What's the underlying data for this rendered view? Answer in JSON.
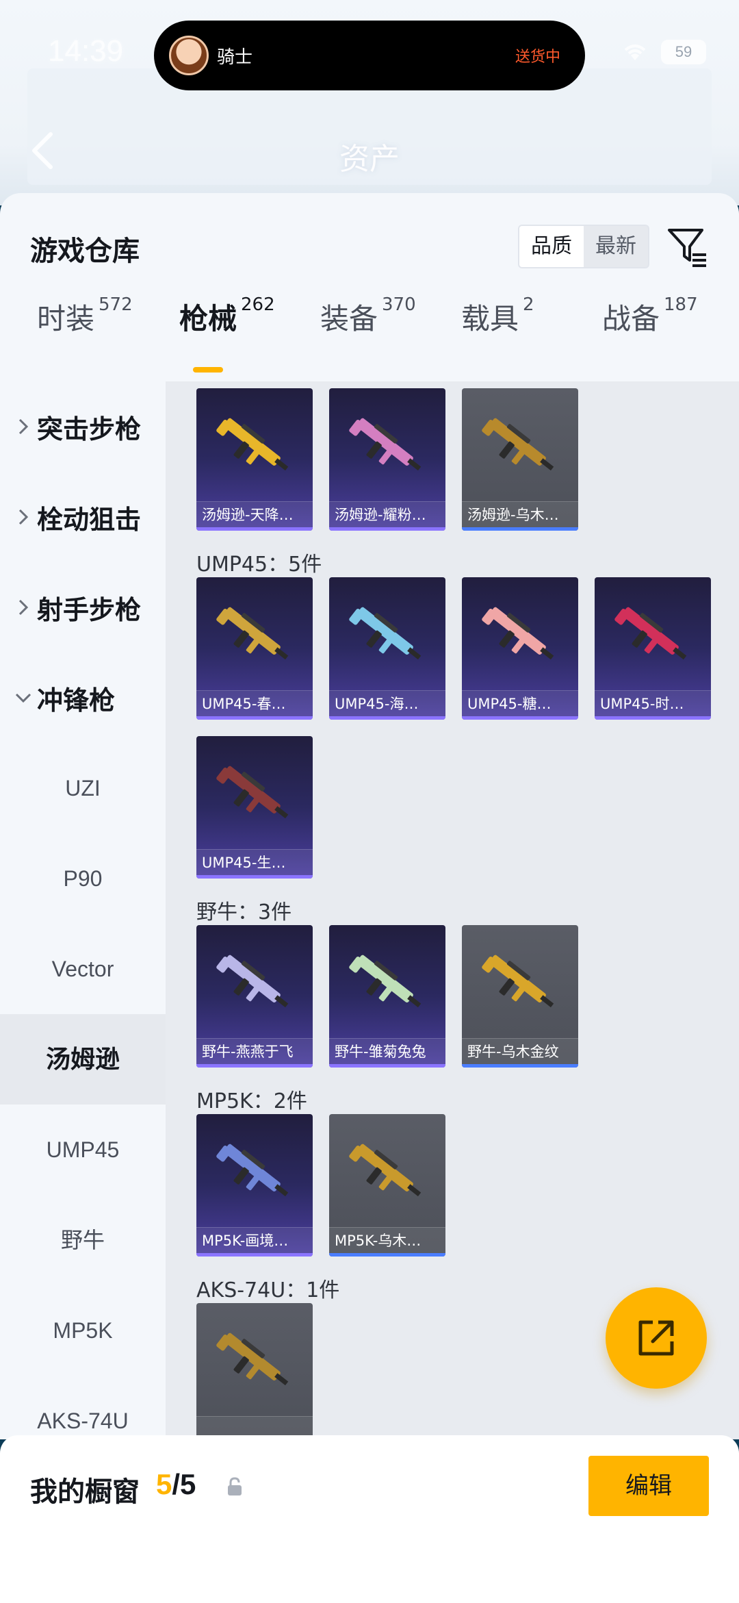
{
  "status_bar": {
    "time": "14:39",
    "battery": "59"
  },
  "island": {
    "user": "骑士",
    "status": "送货中"
  },
  "header": {
    "title": "资产"
  },
  "sheet": {
    "title": "游戏仓库",
    "sort_options": [
      "品质",
      "最新"
    ],
    "sort_selected": "品质"
  },
  "tabs": [
    {
      "label": "时装",
      "count": "572"
    },
    {
      "label": "枪械",
      "count": "262"
    },
    {
      "label": "装备",
      "count": "370"
    },
    {
      "label": "载具",
      "count": "2"
    },
    {
      "label": "战备",
      "count": "187"
    }
  ],
  "active_tab": "枪械",
  "sidebar": {
    "categories": [
      {
        "label": "突击步枪",
        "expanded": false
      },
      {
        "label": "栓动狙击",
        "expanded": false
      },
      {
        "label": "射手步枪",
        "expanded": false
      },
      {
        "label": "冲锋枪",
        "expanded": true
      }
    ],
    "subcategories": [
      "UZI",
      "P90",
      "Vector",
      "汤姆逊",
      "UMP45",
      "野牛",
      "MP5K",
      "AKS-74U"
    ],
    "active_sub": "汤姆逊"
  },
  "groups": [
    {
      "label": "",
      "items": [
        {
          "name": "汤姆逊-天降…",
          "rarity": "purple",
          "gun_color": "#e8b62a"
        },
        {
          "name": "汤姆逊-耀粉…",
          "rarity": "purple",
          "gun_color": "#d47fc1"
        },
        {
          "name": "汤姆逊-乌木…",
          "rarity": "grey",
          "gun_color": "#b88a2c"
        }
      ]
    },
    {
      "label": "UMP45：5件",
      "items": [
        {
          "name": "UMP45-春…",
          "rarity": "purple",
          "gun_color": "#cfa53c"
        },
        {
          "name": "UMP45-海…",
          "rarity": "purple",
          "gun_color": "#7ec8e8"
        },
        {
          "name": "UMP45-糖…",
          "rarity": "purple",
          "gun_color": "#f0a6a6"
        },
        {
          "name": "UMP45-时…",
          "rarity": "purple",
          "gun_color": "#d2305a"
        },
        {
          "name": "UMP45-生…",
          "rarity": "purple",
          "gun_color": "#8a3a3a"
        }
      ]
    },
    {
      "label": "野牛：3件",
      "items": [
        {
          "name": "野牛-燕燕于飞",
          "rarity": "purple",
          "gun_color": "#b9b6e8"
        },
        {
          "name": "野牛-雏菊兔兔",
          "rarity": "purple",
          "gun_color": "#bfe0b8"
        },
        {
          "name": "野牛-乌木金纹",
          "rarity": "grey",
          "gun_color": "#d9a62a"
        }
      ]
    },
    {
      "label": "MP5K：2件",
      "items": [
        {
          "name": "MP5K-画境…",
          "rarity": "purple",
          "gun_color": "#6f86d8"
        },
        {
          "name": "MP5K-乌木…",
          "rarity": "grey",
          "gun_color": "#c99a2c"
        }
      ]
    },
    {
      "label": "AKS-74U：1件",
      "items": [
        {
          "name": "",
          "rarity": "grey",
          "gun_color": "#b38a2e"
        }
      ]
    }
  ],
  "bottom_bar": {
    "label": "我的橱窗",
    "count_current": "5",
    "count_total": "/5",
    "edit_label": "编辑"
  },
  "colors": {
    "accent": "#ffb400",
    "purple_card": "#4c3fa0",
    "grey_card": "#50535c"
  },
  "icons": [
    "back-icon",
    "wifi-icon",
    "filter-icon",
    "chevron-right-icon",
    "chevron-down-icon",
    "share-icon",
    "lock-icon"
  ]
}
